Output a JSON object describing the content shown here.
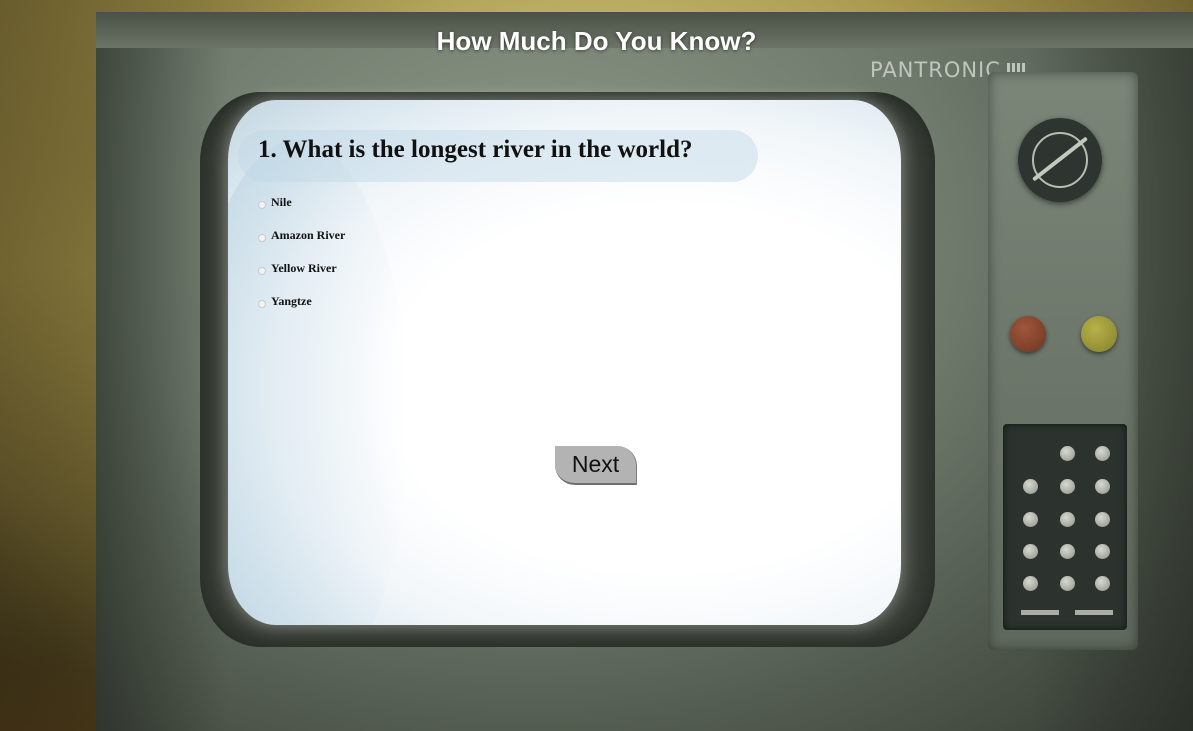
{
  "page": {
    "title": "How Much Do You Know?"
  },
  "tv": {
    "brand": "PANTRONIC"
  },
  "quiz": {
    "question": "1. What is the longest river in the world?",
    "options": [
      {
        "label": "Nile"
      },
      {
        "label": "Amazon River"
      },
      {
        "label": "Yellow River"
      },
      {
        "label": "Yangtze"
      }
    ],
    "next_label": "Next"
  },
  "colors": {
    "background": "#a99a4e",
    "tv_body": "#6f7a6c",
    "screen": "#ffffff",
    "button": "#b3b3b3",
    "knob_red": "#8a4530",
    "knob_yellow": "#a39d3c"
  }
}
